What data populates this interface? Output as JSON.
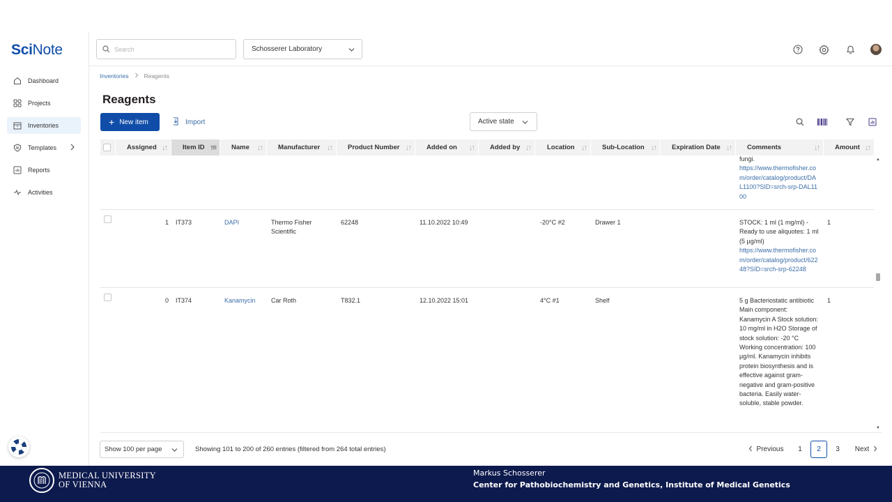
{
  "app": {
    "logo_bold": "Sci",
    "logo_light": "Note"
  },
  "sidebar": {
    "items": [
      {
        "label": "Dashboard",
        "icon": "home-icon"
      },
      {
        "label": "Projects",
        "icon": "grid-icon"
      },
      {
        "label": "Inventories",
        "icon": "box-icon",
        "active": true
      },
      {
        "label": "Templates",
        "icon": "template-icon",
        "has_submenu": true
      },
      {
        "label": "Reports",
        "icon": "chart-icon"
      },
      {
        "label": "Activities",
        "icon": "pulse-icon"
      }
    ]
  },
  "topbar": {
    "search_placeholder": "Search",
    "team": "Schosserer Laboratory"
  },
  "breadcrumb": {
    "parent": "Inventories",
    "current": "Reagents"
  },
  "page": {
    "title": "Reagents",
    "new_item_label": "New item",
    "import_label": "Import",
    "state_filter": "Active state"
  },
  "table": {
    "columns": [
      "Assigned",
      "Item ID",
      "Name",
      "Manufacturer",
      "Product Number",
      "Added on",
      "Added by",
      "Location",
      "Sub-Location",
      "Expiration Date",
      "Comments",
      "Amount"
    ],
    "sorted_column": "Item ID",
    "partial_row": {
      "comment_text": "fungi.",
      "comment_url": "https://www.thermofisher.com/order/catalog/product/DAL1100?SID=srch-srp-DAL1100"
    },
    "rows": [
      {
        "assigned": "1",
        "item_id": "IT373",
        "name": "DAPI",
        "manufacturer": "Thermo Fisher Scientific",
        "product_number": "62248",
        "added_on": "11.10.2022 10:49",
        "added_by": "",
        "location": "-20°C #2",
        "sub_location": "Drawer 1",
        "expiration": "",
        "comment_text": "STOCK: 1 ml (1 mg/ml) - Ready to use aliquotes: 1 ml (5 µg/ml)",
        "comment_url": "https://www.thermofisher.com/order/catalog/product/62248?SID=srch-srp-62248",
        "amount": "1"
      },
      {
        "assigned": "0",
        "item_id": "IT374",
        "name": "Kanamycin",
        "manufacturer": "Car Roth",
        "product_number": "T832.1",
        "added_on": "12.10.2022 15:01",
        "added_by": "",
        "location": "4°C #1",
        "sub_location": "Shelf",
        "expiration": "",
        "comment_text": "5 g Bacteriostatic antibiotic Main component: Kanamycin A Stock solution: 10 mg/ml in H2O Storage of stock solution: -20 °C Working concentration: 100 µg/ml. Kanamycin inhibits protein biosynthesis and is effective against gram-negative and gram-positive bacteria. Easily water-soluble, stable powder.",
        "comment_url": "",
        "amount": "1"
      }
    ]
  },
  "footer": {
    "per_page": "Show 100 per page",
    "entries": "Showing 101 to 200 of 260 entries (filtered from 264 total entries)",
    "previous": "Previous",
    "pages": [
      "1",
      "2",
      "3"
    ],
    "current_page": "2",
    "next": "Next"
  },
  "banner": {
    "university_line1": "MEDICAL UNIVERSITY",
    "university_line2": "OF VIENNA",
    "author": "Markus Schosserer",
    "affiliation": "Center for Pathobiochemistry and Genetics, Institute of Medical Genetics"
  },
  "colors": {
    "brand": "#104da9",
    "link": "#3c6ea8",
    "banner": "#0d1a4d"
  }
}
